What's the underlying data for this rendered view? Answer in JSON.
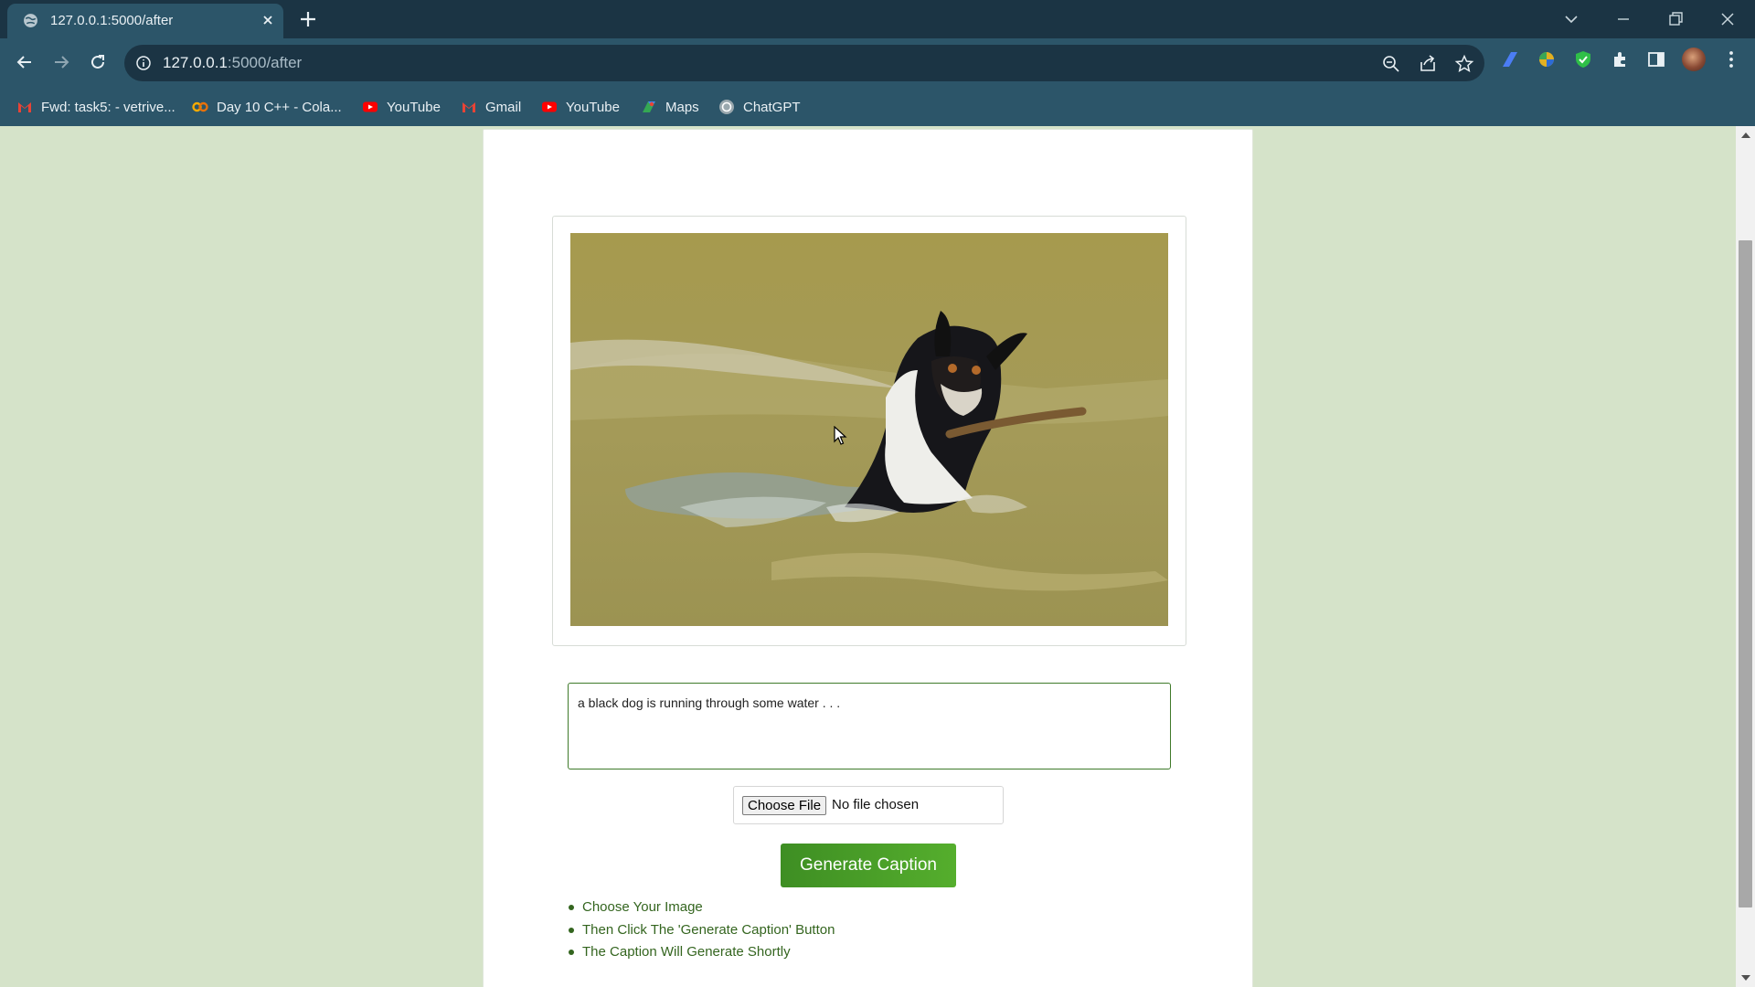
{
  "browser": {
    "tab_title": "127.0.0.1:5000/after",
    "url_host": "127.0.0.1",
    "url_rest": ":5000/after",
    "bookmarks": [
      {
        "label": "Fwd: task5: - vetrive...",
        "icon": "gmail-icon"
      },
      {
        "label": "Day 10 C++ - Cola...",
        "icon": "colab-icon"
      },
      {
        "label": "YouTube",
        "icon": "youtube-icon"
      },
      {
        "label": "Gmail",
        "icon": "gmail-icon"
      },
      {
        "label": "YouTube",
        "icon": "youtube-icon"
      },
      {
        "label": "Maps",
        "icon": "maps-icon"
      },
      {
        "label": "ChatGPT",
        "icon": "chatgpt-icon"
      }
    ]
  },
  "page": {
    "caption_text": "a black dog is running through some water . . .",
    "choose_file_label": "Choose File",
    "no_file_text": "No file chosen",
    "generate_label": "Generate Caption",
    "steps": [
      "Choose Your Image",
      "Then Click The 'Generate Caption' Button",
      "The Caption Will Generate Shortly"
    ],
    "image_alt": "dog swimming with stick"
  },
  "colors": {
    "page_bg": "#d5e3c9",
    "accent_green": "#4a9e28",
    "chrome_dark": "#1b3444",
    "chrome_mid": "#2c5569"
  }
}
